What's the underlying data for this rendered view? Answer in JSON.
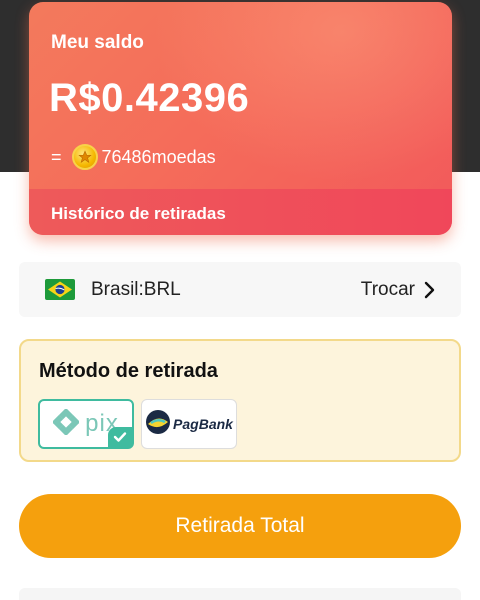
{
  "wallet": {
    "balance_label": "Meu saldo",
    "balance_amount": "R$0.42396",
    "coins_prefix": "=",
    "coins_amount": "76486moedas",
    "history_link": "Histórico de retiradas"
  },
  "currency": {
    "label": "Brasil:BRL",
    "change_label": "Trocar",
    "flag_icon": "brazil-flag-icon"
  },
  "withdraw_method": {
    "title": "Método de retirada",
    "options": [
      {
        "name": "pix",
        "text": "pix",
        "selected": true
      },
      {
        "name": "pagbank",
        "text": "PagBank",
        "selected": false
      }
    ]
  },
  "actions": {
    "withdraw_all_label": "Retirada Total"
  },
  "colors": {
    "card_gradient_start": "#f37a5c",
    "card_gradient_end": "#f2595b",
    "button_orange": "#f5a00d",
    "method_bg": "#fdf4dc",
    "pix_green": "#3fbb9f"
  }
}
